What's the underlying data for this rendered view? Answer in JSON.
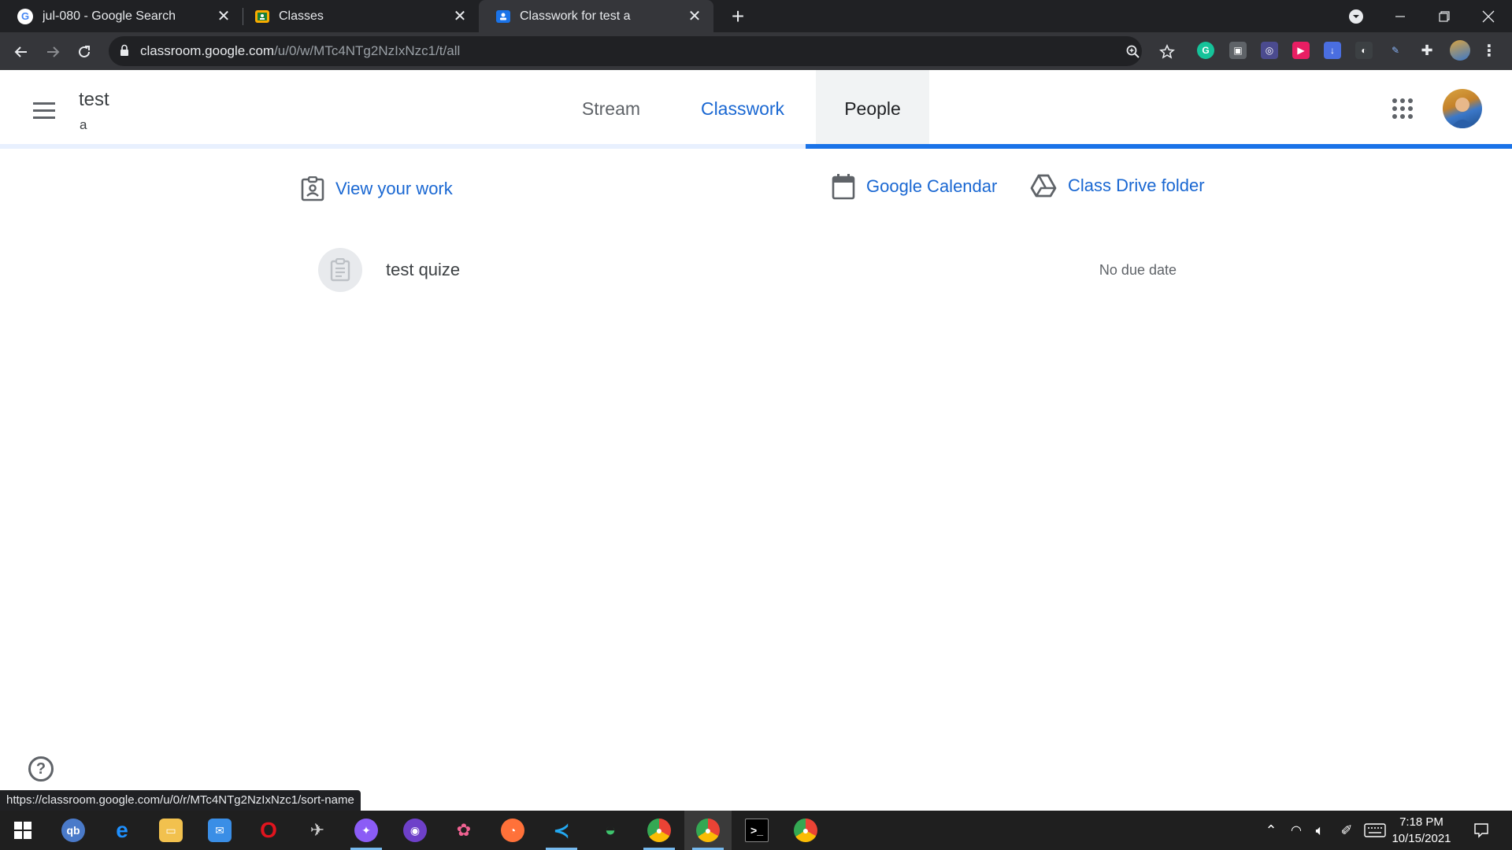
{
  "browser": {
    "tabs": [
      {
        "title": "jul-080 - Google Search",
        "favicon": "google-g-icon"
      },
      {
        "title": "Classes",
        "favicon": "classroom-icon"
      },
      {
        "title": "Classwork for test a",
        "favicon": "classroom-icon",
        "active": true
      }
    ],
    "url_host": "classroom.google.com",
    "url_path": "/u/0/w/MTc4NTg2NzIxNzc1/t/all",
    "status_url": "https://classroom.google.com/u/0/r/MTc4NTg2NzIxNzc1/sort-name",
    "new_tab_symbol": "+"
  },
  "header": {
    "class_name": "test",
    "class_section": "a",
    "tabs": [
      {
        "label": "Stream"
      },
      {
        "label": "Classwork",
        "active": true
      },
      {
        "label": "People",
        "hovered": true
      }
    ]
  },
  "classwork": {
    "view_your_work": "View your work",
    "google_calendar": "Google Calendar",
    "class_drive_folder": "Class Drive folder",
    "items": [
      {
        "title": "test quize",
        "due": "No due date"
      }
    ]
  },
  "help_symbol": "?",
  "taskbar": {
    "time": "7:18 PM",
    "date": "10/15/2021"
  },
  "colors": {
    "accent": "#1967d2",
    "indicator": "#1a73e8",
    "chrome_dark": "#202124",
    "chrome_toolbar": "#35363a"
  }
}
